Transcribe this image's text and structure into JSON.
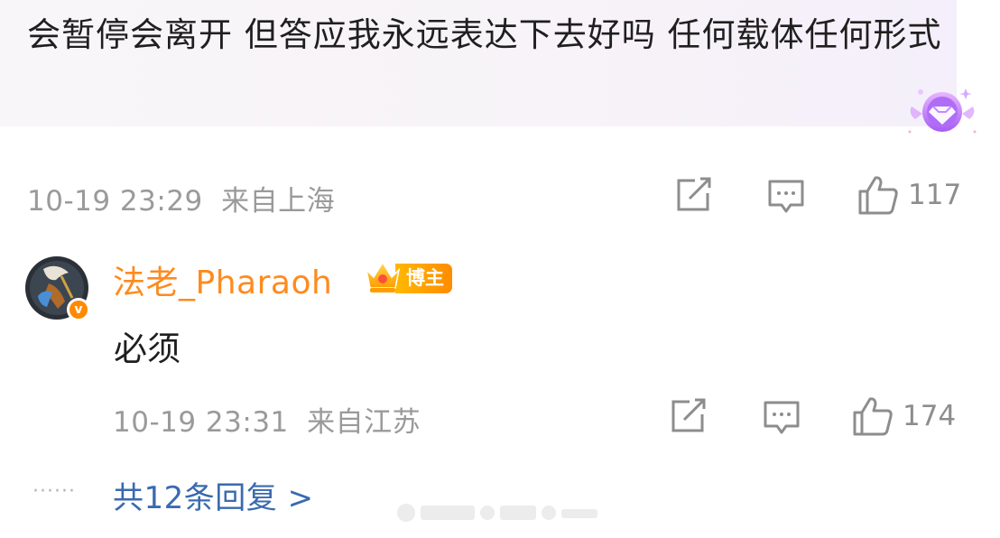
{
  "parent_comment": {
    "text": "会暂停会离开 但答应我永远表达下去好吗 任何载体任何形式",
    "time": "10-19 23:29",
    "location": "来自上海",
    "like_count": "117",
    "badge_icon": "diamond-vip-icon"
  },
  "reply": {
    "author": "法老_Pharaoh",
    "author_badge": "博主",
    "text": "必须",
    "time": "10-19 23:31",
    "location": "来自江苏",
    "like_count": "174",
    "verified_icon": "verified-v-icon"
  },
  "more_replies": {
    "dots": "······",
    "label": "共12条回复 >"
  },
  "colors": {
    "username": "#ff8a1e",
    "link": "#3a6ab0",
    "meta": "#9a9a9a",
    "verified": "#ff8a00"
  }
}
